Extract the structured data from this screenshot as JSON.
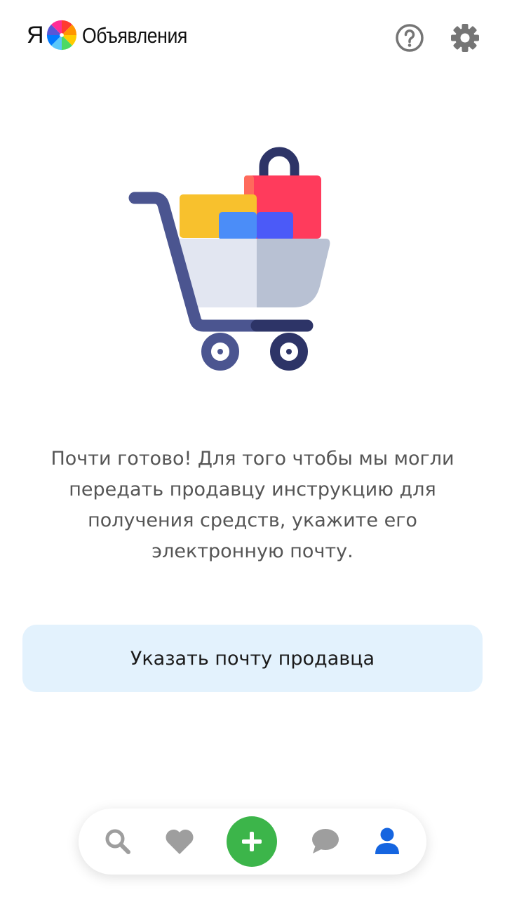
{
  "header": {
    "logo_letter": "Я",
    "logo_text": "Объявления",
    "icons": {
      "help": "help-circle-icon",
      "settings": "gear-icon"
    }
  },
  "illustration": {
    "name": "shopping-cart-illustration",
    "colors": {
      "frame": "#4b5590",
      "frame_dark": "#2d3467",
      "basket_light": "#e2e6f1",
      "basket_dark": "#b8c1d3",
      "yellow_box": "#f8c12d",
      "red_bag": "#ff3b5c",
      "blue_box": "#4b8df8",
      "blue_box_dark": "#4b5af8"
    }
  },
  "message": {
    "text": "Почти готово! Для того чтобы мы могли передать продавцу инструкцию для получения средств, укажите его электронную почту."
  },
  "action": {
    "label": "Указать почту продавца",
    "background": "#e3f2fd"
  },
  "bottom_nav": {
    "items": [
      {
        "icon": "search-icon",
        "active": false
      },
      {
        "icon": "heart-icon",
        "active": false
      },
      {
        "icon": "plus-icon",
        "active": false
      },
      {
        "icon": "chat-icon",
        "active": false
      },
      {
        "icon": "profile-icon",
        "active": true
      }
    ],
    "accent_color": "#3cb54a",
    "active_color": "#1565e0",
    "inactive_color": "#9e9e9e"
  }
}
